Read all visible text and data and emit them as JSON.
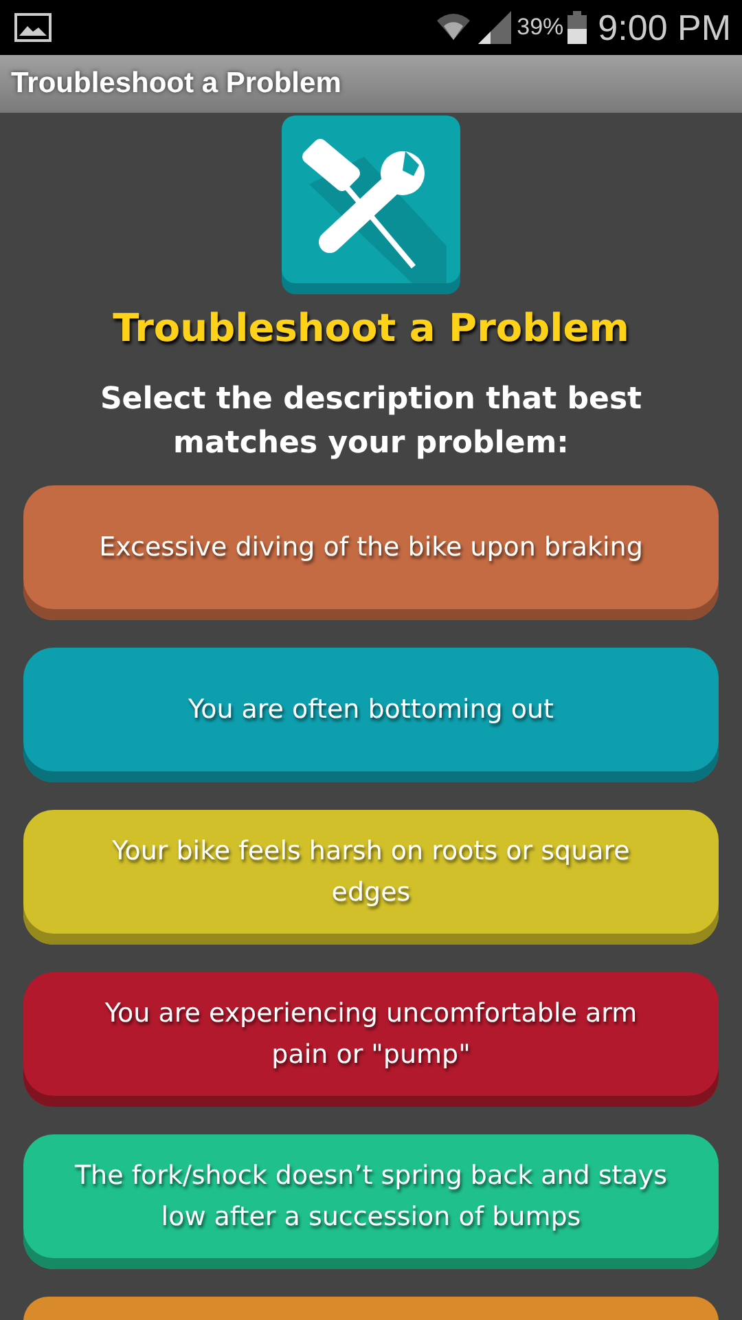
{
  "status_bar": {
    "battery": "39%",
    "time": "9:00 PM"
  },
  "title_bar": {
    "title": "Troubleshoot a Problem"
  },
  "heading": "Troubleshoot a Problem",
  "instruction": "Select the description that best matches your problem:",
  "problems": [
    {
      "label": "Excessive diving of the bike upon braking",
      "color": "#c56b43"
    },
    {
      "label": "You are often bottoming out",
      "color": "#0e9fae"
    },
    {
      "label": "Your bike feels harsh on roots or square edges",
      "color": "#d1c02a"
    },
    {
      "label": "You are experiencing uncomfortable arm pain or \"pump\"",
      "color": "#b3192d"
    },
    {
      "label": "The fork/shock doesn’t spring back and stays low after a succession of bumps",
      "color": "#1fc08c"
    },
    {
      "color": "#d98a2a"
    }
  ]
}
